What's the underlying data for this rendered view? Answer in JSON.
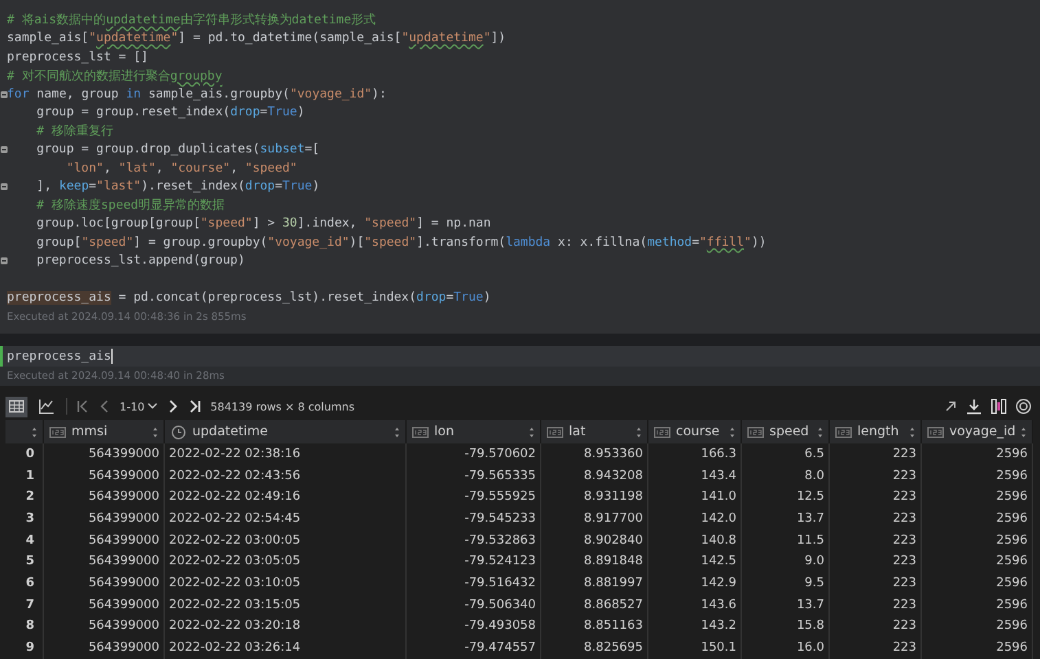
{
  "code_cell": {
    "blocks": [
      {
        "lines": [
          {
            "fold": false,
            "tokens": [
              {
                "kind": "cmt",
                "text": "# 将ais数据中的"
              },
              {
                "kind": "cmt",
                "text": "updatetime",
                "flagged": true
              },
              {
                "kind": "cmt",
                "text": "由字符串形式转换为datetime形式"
              }
            ]
          },
          {
            "fold": false,
            "tokens": [
              {
                "kind": "plain",
                "text": "sample_ais["
              },
              {
                "kind": "str",
                "text": "\""
              },
              {
                "kind": "str",
                "text": "updatetime",
                "flagged": true
              },
              {
                "kind": "str",
                "text": "\""
              },
              {
                "kind": "plain",
                "text": "] = pd.to_datetime(sample_ais["
              },
              {
                "kind": "str",
                "text": "\""
              },
              {
                "kind": "str",
                "text": "updatetime",
                "flagged": true
              },
              {
                "kind": "str",
                "text": "\""
              },
              {
                "kind": "plain",
                "text": "])"
              }
            ]
          },
          {
            "fold": false,
            "tokens": [
              {
                "kind": "plain",
                "text": "preprocess_lst = []"
              }
            ]
          },
          {
            "fold": false,
            "tokens": [
              {
                "kind": "cmt",
                "text": "# 对不同航次的数据进行聚合"
              },
              {
                "kind": "cmt",
                "text": "groupby",
                "flagged": true
              }
            ]
          },
          {
            "fold": true,
            "tokens": [
              {
                "kind": "kw",
                "text": "for"
              },
              {
                "kind": "plain",
                "text": " name, group "
              },
              {
                "kind": "kw",
                "text": "in"
              },
              {
                "kind": "plain",
                "text": " sample_ais.groupby("
              },
              {
                "kind": "str",
                "text": "\"voyage_id\""
              },
              {
                "kind": "plain",
                "text": "):"
              }
            ],
            "children": [
              {
                "fold": false,
                "tokens": [
                  {
                    "kind": "plain",
                    "text": "group = group.reset_index("
                  },
                  {
                    "kind": "param",
                    "text": "drop"
                  },
                  {
                    "kind": "plain",
                    "text": "="
                  },
                  {
                    "kind": "kw",
                    "text": "True"
                  },
                  {
                    "kind": "plain",
                    "text": ")"
                  }
                ]
              },
              {
                "fold": false,
                "tokens": [
                  {
                    "kind": "cmt",
                    "text": "# 移除重复行"
                  }
                ]
              },
              {
                "fold": true,
                "tokens": [
                  {
                    "kind": "plain",
                    "text": "group = group.drop_duplicates("
                  },
                  {
                    "kind": "param",
                    "text": "subset"
                  },
                  {
                    "kind": "plain",
                    "text": "=["
                  }
                ],
                "children": [
                  {
                    "fold": false,
                    "tokens": [
                      {
                        "kind": "str",
                        "text": "\"lon\""
                      },
                      {
                        "kind": "plain",
                        "text": ", "
                      },
                      {
                        "kind": "str",
                        "text": "\"lat\""
                      },
                      {
                        "kind": "plain",
                        "text": ", "
                      },
                      {
                        "kind": "str",
                        "text": "\"course\""
                      },
                      {
                        "kind": "plain",
                        "text": ", "
                      },
                      {
                        "kind": "str",
                        "text": "\"speed\""
                      }
                    ]
                  }
                ]
              },
              {
                "fold": true,
                "tokens": [
                  {
                    "kind": "plain",
                    "text": "], "
                  },
                  {
                    "kind": "param",
                    "text": "keep"
                  },
                  {
                    "kind": "plain",
                    "text": "="
                  },
                  {
                    "kind": "str",
                    "text": "\"last\""
                  },
                  {
                    "kind": "plain",
                    "text": ").reset_index("
                  },
                  {
                    "kind": "param",
                    "text": "drop"
                  },
                  {
                    "kind": "plain",
                    "text": "="
                  },
                  {
                    "kind": "kw",
                    "text": "True"
                  },
                  {
                    "kind": "plain",
                    "text": ")"
                  }
                ]
              },
              {
                "fold": false,
                "tokens": [
                  {
                    "kind": "cmt",
                    "text": "# 移除速度speed明显异常的数据"
                  }
                ]
              },
              {
                "fold": false,
                "tokens": [
                  {
                    "kind": "plain",
                    "text": "group.loc[group[group["
                  },
                  {
                    "kind": "str",
                    "text": "\"speed\""
                  },
                  {
                    "kind": "plain",
                    "text": "] > "
                  },
                  {
                    "kind": "num",
                    "text": "30"
                  },
                  {
                    "kind": "plain",
                    "text": "].index, "
                  },
                  {
                    "kind": "str",
                    "text": "\"speed\""
                  },
                  {
                    "kind": "plain",
                    "text": "] = np.nan"
                  }
                ]
              },
              {
                "fold": false,
                "tokens": [
                  {
                    "kind": "plain",
                    "text": "group["
                  },
                  {
                    "kind": "str",
                    "text": "\"speed\""
                  },
                  {
                    "kind": "plain",
                    "text": "] = group.groupby("
                  },
                  {
                    "kind": "str",
                    "text": "\"voyage_id\""
                  },
                  {
                    "kind": "plain",
                    "text": ")["
                  },
                  {
                    "kind": "str",
                    "text": "\"speed\""
                  },
                  {
                    "kind": "plain",
                    "text": "].transform("
                  },
                  {
                    "kind": "kw",
                    "text": "lambda"
                  },
                  {
                    "kind": "plain",
                    "text": " x: x.fillna("
                  },
                  {
                    "kind": "param",
                    "text": "method"
                  },
                  {
                    "kind": "plain",
                    "text": "="
                  },
                  {
                    "kind": "str",
                    "text": "\""
                  },
                  {
                    "kind": "str",
                    "text": "ffill",
                    "flagged": true
                  },
                  {
                    "kind": "str",
                    "text": "\""
                  },
                  {
                    "kind": "plain",
                    "text": "))"
                  }
                ]
              },
              {
                "fold": true,
                "tokens": [
                  {
                    "kind": "plain",
                    "text": "preprocess_lst.append(group)"
                  }
                ]
              }
            ]
          }
        ]
      },
      {
        "lines": [
          {
            "fold": false,
            "tokens": [
              {
                "kind": "hl",
                "text": "preprocess_ais"
              },
              {
                "kind": "plain",
                "text": " = pd.concat(preprocess_lst).reset_index("
              },
              {
                "kind": "param",
                "text": "drop"
              },
              {
                "kind": "plain",
                "text": "="
              },
              {
                "kind": "kw",
                "text": "True"
              },
              {
                "kind": "plain",
                "text": ")"
              }
            ]
          }
        ]
      }
    ],
    "status": "Executed at 2024.09.14 00:48:36 in 2s 855ms"
  },
  "input_cell": {
    "value": "preprocess_ais",
    "status": "Executed at 2024.09.14 00:48:40 in 28ms"
  },
  "table_toolbar": {
    "views": [
      {
        "kind": "table",
        "selected": true
      },
      {
        "kind": "chart",
        "selected": false
      }
    ],
    "page_range": "1-10",
    "summary": "584139 rows × 8 columns"
  },
  "table": {
    "columns": [
      {
        "name": "mmsi",
        "kind": "number"
      },
      {
        "name": "updatetime",
        "kind": "datetime"
      },
      {
        "name": "lon",
        "kind": "number"
      },
      {
        "name": "lat",
        "kind": "number"
      },
      {
        "name": "course",
        "kind": "number"
      },
      {
        "name": "speed",
        "kind": "number"
      },
      {
        "name": "length",
        "kind": "number"
      },
      {
        "name": "voyage_id",
        "kind": "number"
      }
    ],
    "rows": [
      {
        "index": "0",
        "cells": [
          "564399000",
          "2022-02-22 02:38:16",
          "-79.570602",
          "8.953360",
          "166.3",
          "6.5",
          "223",
          "2596"
        ]
      },
      {
        "index": "1",
        "cells": [
          "564399000",
          "2022-02-22 02:43:56",
          "-79.565335",
          "8.943208",
          "143.4",
          "8.0",
          "223",
          "2596"
        ]
      },
      {
        "index": "2",
        "cells": [
          "564399000",
          "2022-02-22 02:49:16",
          "-79.555925",
          "8.931198",
          "141.0",
          "12.5",
          "223",
          "2596"
        ]
      },
      {
        "index": "3",
        "cells": [
          "564399000",
          "2022-02-22 02:54:45",
          "-79.545233",
          "8.917700",
          "142.0",
          "13.7",
          "223",
          "2596"
        ]
      },
      {
        "index": "4",
        "cells": [
          "564399000",
          "2022-02-22 03:00:05",
          "-79.532863",
          "8.902840",
          "140.8",
          "11.5",
          "223",
          "2596"
        ]
      },
      {
        "index": "5",
        "cells": [
          "564399000",
          "2022-02-22 03:05:05",
          "-79.524123",
          "8.891848",
          "142.5",
          "9.0",
          "223",
          "2596"
        ]
      },
      {
        "index": "6",
        "cells": [
          "564399000",
          "2022-02-22 03:10:05",
          "-79.516432",
          "8.881997",
          "142.9",
          "9.5",
          "223",
          "2596"
        ]
      },
      {
        "index": "7",
        "cells": [
          "564399000",
          "2022-02-22 03:15:05",
          "-79.506340",
          "8.868527",
          "143.6",
          "13.7",
          "223",
          "2596"
        ]
      },
      {
        "index": "8",
        "cells": [
          "564399000",
          "2022-02-22 03:20:18",
          "-79.493058",
          "8.851163",
          "143.2",
          "15.8",
          "223",
          "2596"
        ]
      },
      {
        "index": "9",
        "cells": [
          "564399000",
          "2022-02-22 03:26:14",
          "-79.474557",
          "8.825695",
          "150.1",
          "16.0",
          "223",
          "2596"
        ]
      }
    ]
  }
}
